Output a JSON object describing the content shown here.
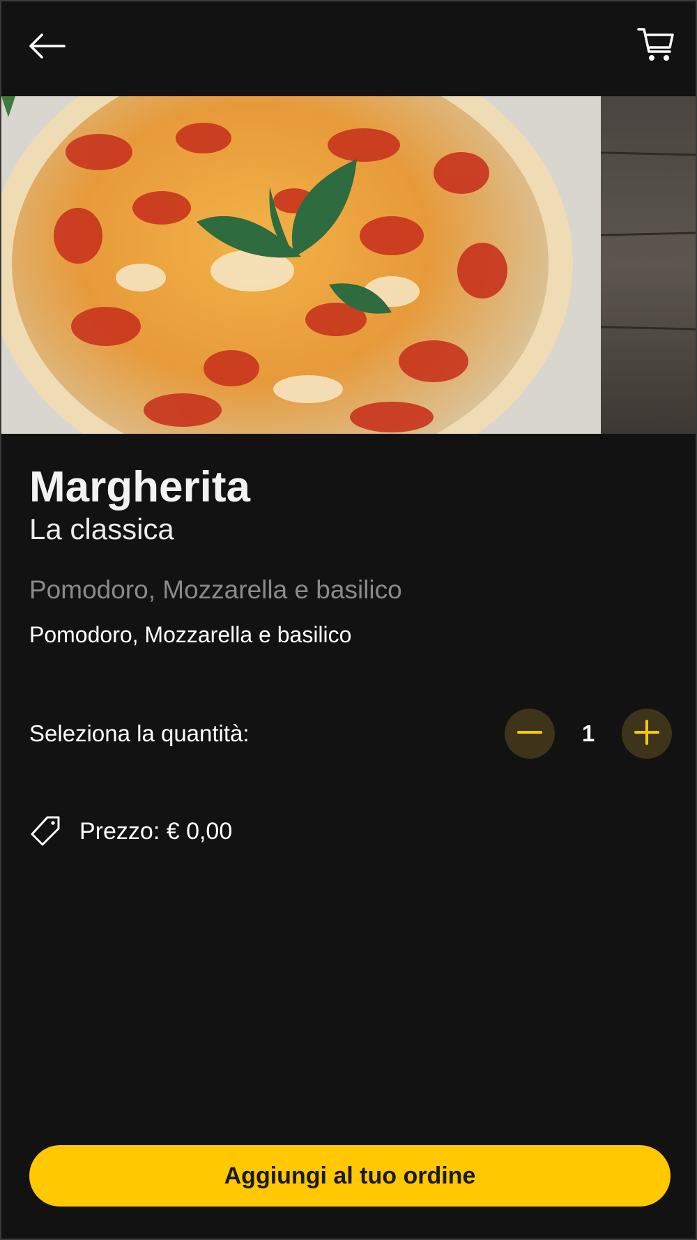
{
  "header": {
    "back_icon": "arrow-left-icon",
    "cart_icon": "shopping-cart-icon"
  },
  "product": {
    "image": "pizza-margherita-photo",
    "name": "Margherita",
    "subtitle": "La classica",
    "ingredients_muted": "Pomodoro, Mozzarella e basilico",
    "ingredients": "Pomodoro, Mozzarella e basilico"
  },
  "quantity": {
    "label": "Seleziona la quantità:",
    "value": "1",
    "decrement_icon": "minus-icon",
    "increment_icon": "plus-icon"
  },
  "price": {
    "icon": "price-tag-icon",
    "label": "Prezzo: € 0,00"
  },
  "cta": {
    "label": "Aggiungi al tuo ordine"
  },
  "colors": {
    "background": "#121212",
    "accent": "#ffc800",
    "stepper_bg": "#3d3419",
    "muted_text": "#8a8a8a"
  }
}
